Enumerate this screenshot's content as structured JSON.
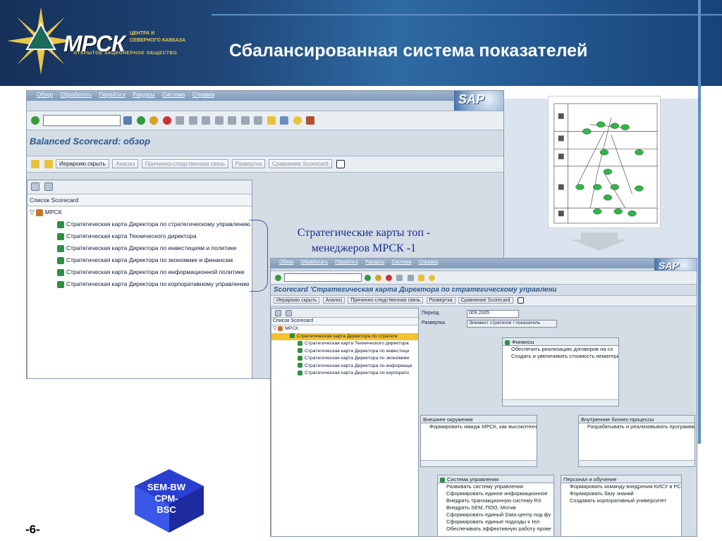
{
  "slide": {
    "title": "Сбалансированная система показателей",
    "page_number": "-6-",
    "logo": {
      "text": "МРСК",
      "sub1": "ЦЕНТРА И",
      "sub2": "СЕВЕРНОГО КАВКАЗА",
      "sub3": "ОТКРЫТОЕ АКЦИОНЕРНОЕ ОБЩЕСТВО"
    },
    "annotation": "Стратегические карты топ - менеджеров МРСК -1",
    "cube_label": [
      "SEM-BW",
      "CPM-",
      "BSC"
    ]
  },
  "window1": {
    "menu": [
      "Обзор",
      "Обработать",
      "Перейти к",
      "Ракурсы",
      "Система",
      "Справка"
    ],
    "app_title": "Balanced Scorecard: обзор",
    "buttons": [
      "Иерархию скрыть",
      "Анализ",
      "Причинно-следственная связь",
      "Развертка",
      "Сравнение Scorecard"
    ],
    "tree_header": "Список Scorecard",
    "root": "МРСК",
    "items": [
      "Стратегическая карта Директора по стратегическому управлению",
      "Стратегическая карта Технического директора",
      "Стратегическая карта Директора по инвестициям и политике",
      "Стратегическая карта Директора по экономике и финансам",
      "Стратегическая карта Директора по информационной политике",
      "Стратегическая карта Директора по корпоративному управлению"
    ]
  },
  "window2": {
    "menu": [
      "Обзор",
      "Обработать",
      "Перейти к",
      "Ракурсы",
      "Система",
      "Справка"
    ],
    "app_title": "Scorecard 'Стратегическая карта Директора по стратегическому управлени",
    "buttons": [
      "Иерархию скрыть",
      "Анализ",
      "Причинно-следственная связь",
      "Развертка",
      "Сравнение Scorecard"
    ],
    "tree_header": "Список Scorecard",
    "root": "МРСК",
    "items": [
      "Стратегическая карта Директора по стратеги",
      "Стратегическая карта Технического директора",
      "Стратегическая карта Директора по инвестици",
      "Стратегическая карта Директора по экономике",
      "Стратегическая карта Директора по информаци",
      "Стратегическая карта Директора по корпорати"
    ],
    "period_label": "Период",
    "period_value": "009.2005",
    "unfold_label": "Развертка",
    "unfold_value": "Элемент стратегии / показатель",
    "finance": {
      "title": "Финансы",
      "rows": [
        "Обеспечить реализацию договоров на со",
        "Создать и увеличивать стоимость нематери"
      ]
    },
    "env": {
      "title": "Внешнее окружение",
      "rows": [
        "Формировать имидж МРСК, как высокотехно"
      ]
    },
    "bp": {
      "title": "Внутренние бизнес-процессы",
      "rows": [
        "Разрабатывать и реализовывать программы"
      ]
    },
    "mgmt": {
      "title": "Система управления",
      "rows": [
        "Развивать систему управления",
        "Сформировать единое информационное",
        "Внедрять транзакционную систему R3",
        "Внедрять SEM, ПОО, Мотив",
        "Сформировать единый Data-центр под фу",
        "Сформировать единые подходы к тел",
        "Обеспечивать эффективную работу прове"
      ]
    },
    "staff": {
      "title": "Персонал и обучение",
      "rows": [
        "Формировать команду внедрения КИСУ в РСК",
        "Формировать базу знаний",
        "Создавать корпоративный университет"
      ]
    }
  },
  "colors": {
    "accent": "#2c5a8f",
    "header_bg": "#1f4677",
    "highlight": "#f2c230",
    "node_green": "#35b34a"
  }
}
